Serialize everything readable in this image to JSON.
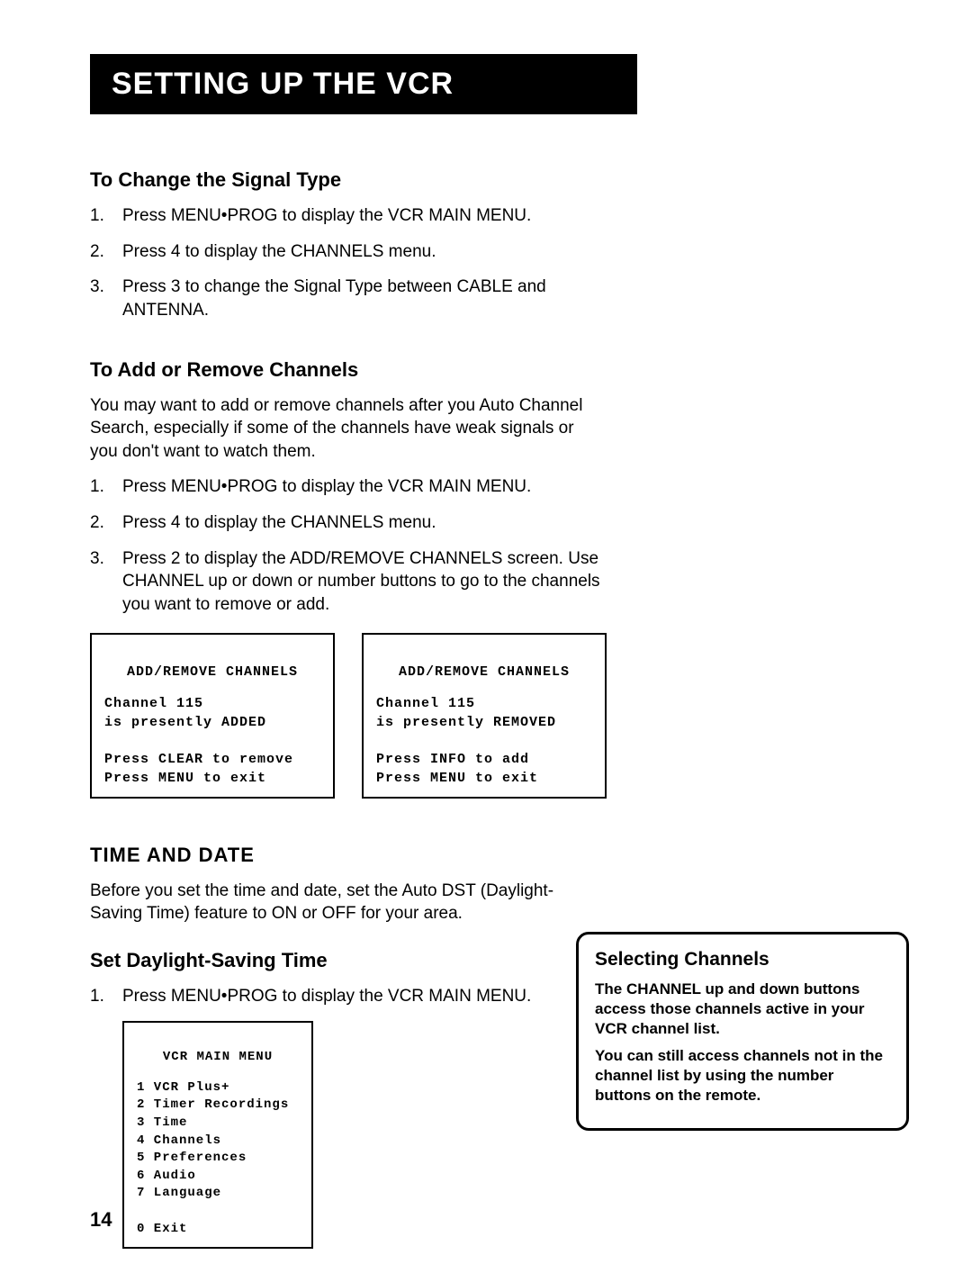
{
  "banner": "SETTING UP THE VCR",
  "sec1": {
    "heading": "To  Change the Signal Type",
    "items": [
      "Press MENU•PROG to display the VCR MAIN MENU.",
      "Press 4 to display the CHANNELS menu.",
      "Press 3 to change the Signal Type between CABLE and ANTENNA."
    ]
  },
  "sec2": {
    "heading": "To Add or Remove Channels",
    "intro": "You may want to add or remove channels after you Auto Channel Search, especially if some of the channels have weak signals or you don't want to watch them.",
    "items": [
      "Press MENU•PROG to display the VCR MAIN MENU.",
      "Press 4 to display the CHANNELS menu.",
      "Press 2 to display the ADD/REMOVE CHANNELS screen. Use CHANNEL up or down or number buttons to go to the channels you want to remove or add."
    ]
  },
  "osd_left": {
    "title": "ADD/REMOVE CHANNELS",
    "l1": "Channel 115",
    "l2": "is presently ADDED",
    "l3": "Press CLEAR to remove",
    "l4": "Press MENU to exit"
  },
  "osd_right": {
    "title": "ADD/REMOVE CHANNELS",
    "l1": "Channel 115",
    "l2": "is presently REMOVED",
    "l3": "Press INFO to add",
    "l4": "Press MENU to exit"
  },
  "sec3": {
    "heading": "TIME AND DATE",
    "intro": "Before you set the time and date, set the Auto DST (Daylight-Saving Time) feature to ON or OFF for your area.",
    "sub": "Set Daylight-Saving Time",
    "items": [
      "Press MENU•PROG to display the VCR MAIN MENU."
    ]
  },
  "main_menu": {
    "title": "VCR MAIN MENU",
    "rows": [
      "1 VCR Plus+",
      "2 Timer Recordings",
      "3 Time",
      "4 Channels",
      "5 Preferences",
      "6 Audio",
      "7 Language",
      "",
      "0 Exit"
    ]
  },
  "sidebar": {
    "title": "Selecting Channels",
    "p1": "The CHANNEL up and down buttons access those channels active in your VCR channel list.",
    "p2": "You can still access channels not in the channel list by using the number buttons on the remote."
  },
  "page_number": "14"
}
